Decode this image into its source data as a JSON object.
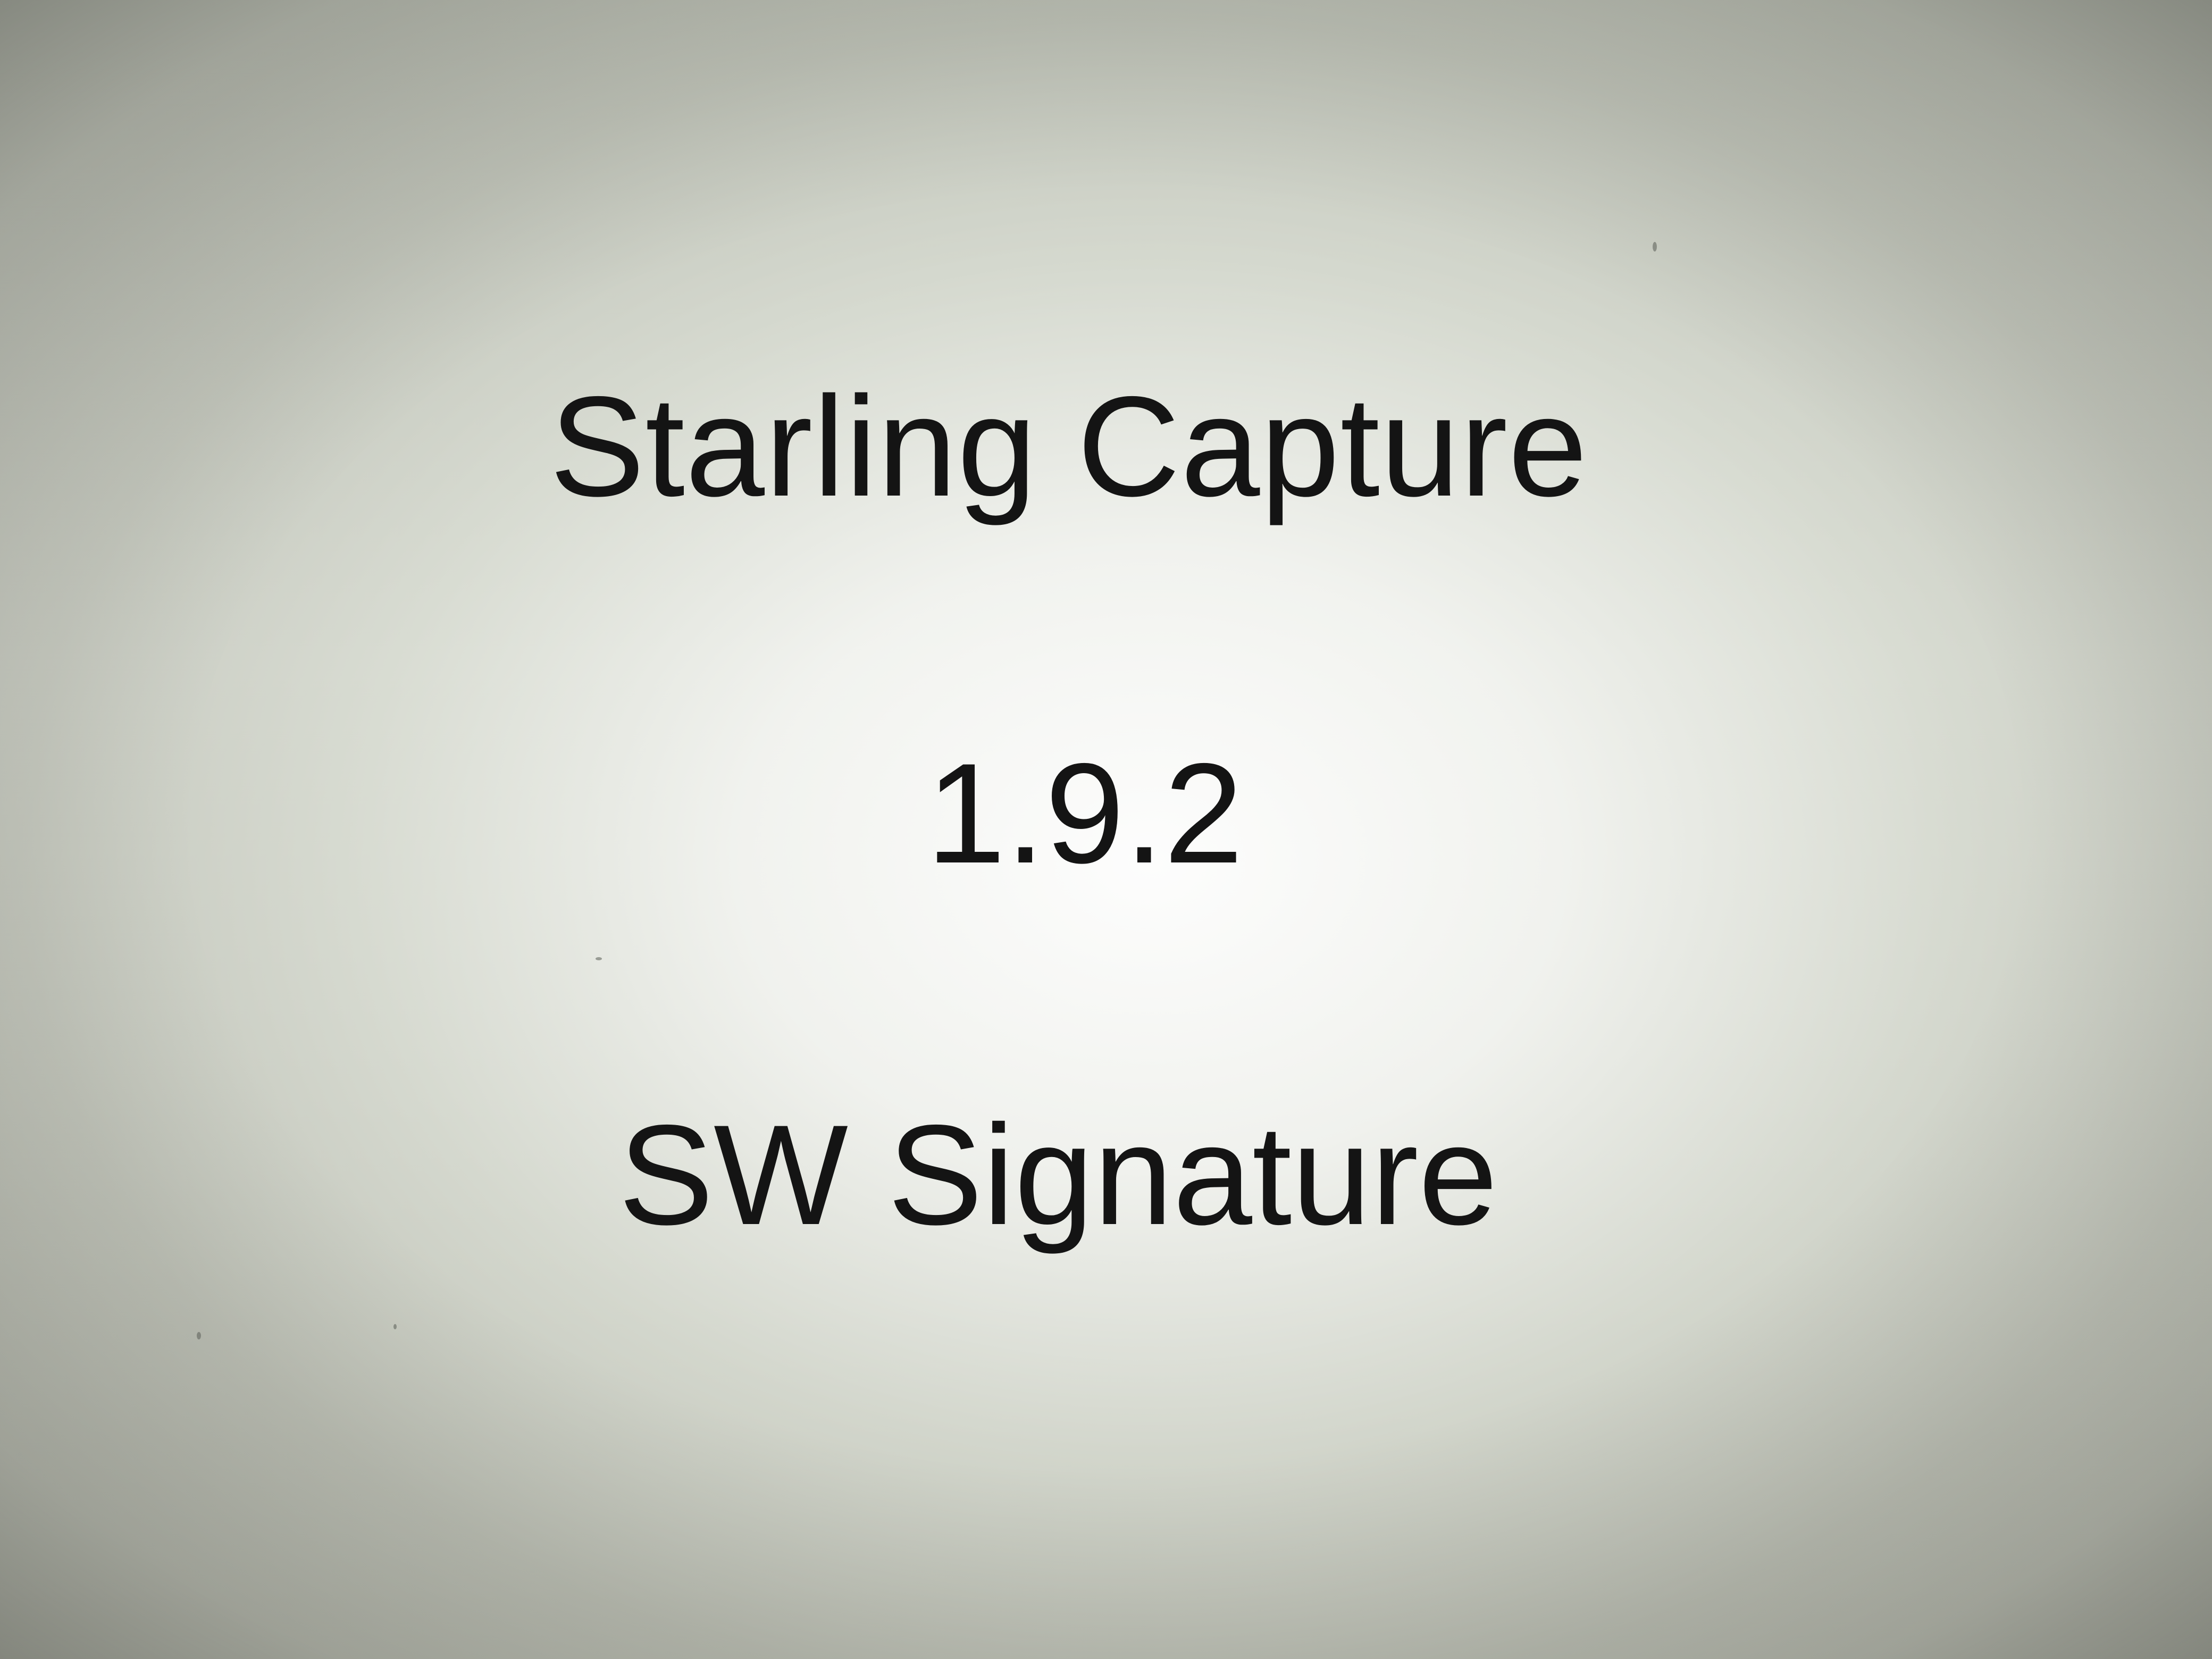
{
  "splash": {
    "app_name": "Starling Capture",
    "version": "1.9.2",
    "signature_label": "SW Signature"
  },
  "colors": {
    "text": "#141414",
    "background": "#e4e6df"
  }
}
